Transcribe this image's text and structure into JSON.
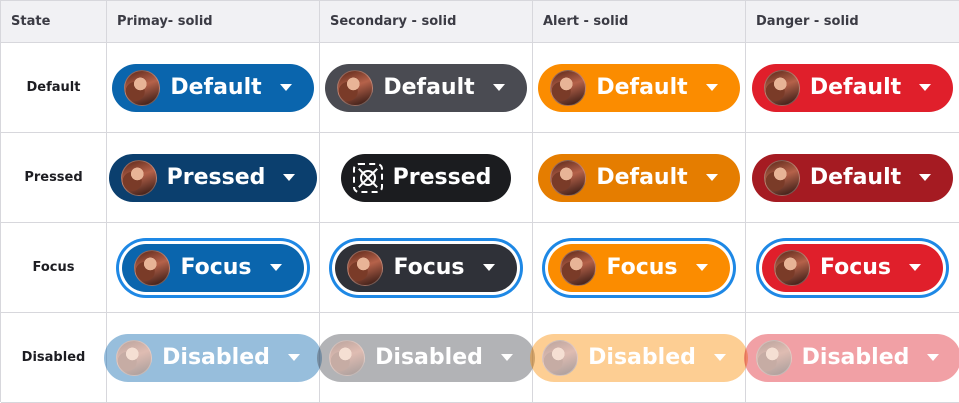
{
  "headers": [
    "State",
    "Primay- solid",
    "Secondary - solid",
    "Alert - solid",
    "Danger - solid"
  ],
  "rows": [
    {
      "state": "Default",
      "buttons": [
        {
          "label": "Default",
          "color": "#0a65ad",
          "icon": "avatar-icon"
        },
        {
          "label": "Default",
          "color": "#4a4b52",
          "icon": "avatar-icon"
        },
        {
          "label": "Default",
          "color": "#fb8c00",
          "icon": "avatar-icon"
        },
        {
          "label": "Default",
          "color": "#e01f2b",
          "icon": "avatar-icon"
        }
      ]
    },
    {
      "state": "Pressed",
      "buttons": [
        {
          "label": "Pressed",
          "color": "#0b3f6e",
          "icon": "avatar-icon"
        },
        {
          "label": "Pressed",
          "color": "#1b1c1f",
          "icon": "placeholder-image-icon"
        },
        {
          "label": "Default",
          "color": "#e57d00",
          "icon": "avatar-icon"
        },
        {
          "label": "Default",
          "color": "#a51b22",
          "icon": "avatar-icon"
        }
      ]
    },
    {
      "state": "Focus",
      "buttons": [
        {
          "label": "Focus",
          "color": "#0a65ad",
          "icon": "avatar-icon"
        },
        {
          "label": "Focus",
          "color": "#2f3138",
          "icon": "avatar-icon"
        },
        {
          "label": "Focus",
          "color": "#fb8c00",
          "icon": "avatar-icon"
        },
        {
          "label": "Focus",
          "color": "#e01f2b",
          "icon": "avatar-icon"
        }
      ]
    },
    {
      "state": "Disabled",
      "buttons": [
        {
          "label": "Disabled",
          "color": "#0a65ad",
          "icon": "avatar-icon"
        },
        {
          "label": "Disabled",
          "color": "#4a4b52",
          "icon": "avatar-icon"
        },
        {
          "label": "Disabled",
          "color": "#fb8c00",
          "icon": "avatar-icon"
        },
        {
          "label": "Disabled",
          "color": "#e01f2b",
          "icon": "avatar-icon"
        }
      ]
    }
  ],
  "focus_ring_color": "#1e88e5"
}
